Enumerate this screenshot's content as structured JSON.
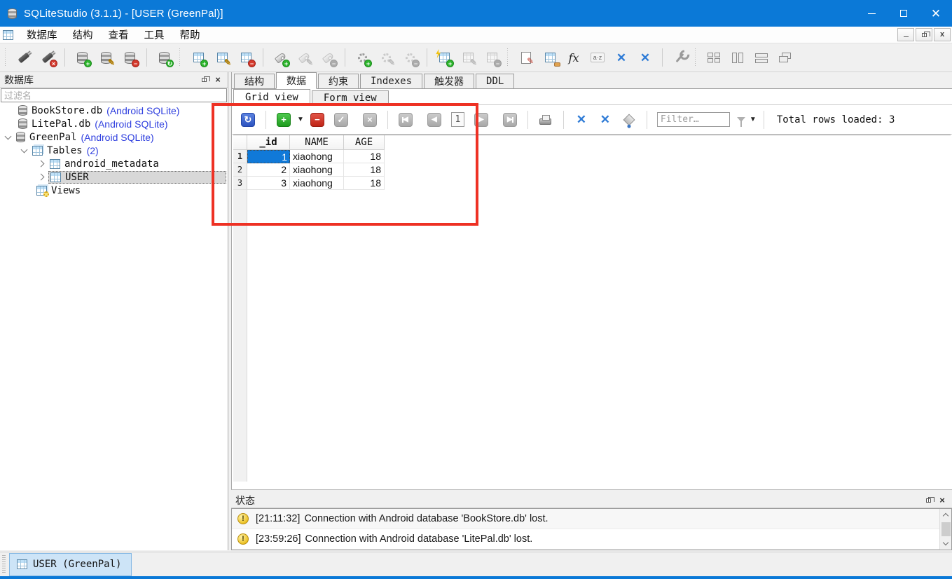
{
  "titlebar": {
    "title": "SQLiteStudio (3.1.1) - [USER (GreenPal)]"
  },
  "menubar": {
    "items": [
      "数据库",
      "结构",
      "查看",
      "工具",
      "帮助"
    ]
  },
  "main_toolbar": {
    "icons": [
      "connect-icon",
      "disconnect-icon",
      "add-database-icon",
      "edit-database-icon",
      "remove-database-icon",
      "refresh-schema-icon",
      "new-table-icon",
      "edit-table-icon",
      "drop-table-icon",
      "add-index-icon",
      "edit-index-icon",
      "drop-index-icon",
      "add-trigger-icon",
      "edit-trigger-icon",
      "drop-trigger-icon",
      "add-view-icon",
      "edit-view-icon",
      "drop-view-icon",
      "open-sql-editor-icon",
      "import-icon",
      "functions-icon",
      "collations-icon",
      "close-all-windows-icon",
      "restore-all-windows-icon",
      "settings-icon",
      "mdi-tile-icon",
      "mdi-tile-vertical-icon",
      "mdi-tile-horizontal-icon",
      "mdi-cascade-icon"
    ]
  },
  "databases_panel": {
    "title": "数据库",
    "filter_placeholder": "过滤名",
    "tree": [
      {
        "label": "BookStore.db",
        "suffix": "(Android SQLite)"
      },
      {
        "label": "LitePal.db",
        "suffix": "(Android SQLite)"
      },
      {
        "label": "GreenPal",
        "suffix": "(Android SQLite)"
      },
      {
        "label": "Tables",
        "suffix": "(2)"
      },
      {
        "label": "android_metadata",
        "suffix": ""
      },
      {
        "label": "USER",
        "suffix": ""
      },
      {
        "label": "Views",
        "suffix": ""
      }
    ]
  },
  "editor": {
    "tabs": [
      "结构",
      "数据",
      "约束",
      "Indexes",
      "触发器",
      "DDL"
    ],
    "active_tab": "数据",
    "view_tabs": [
      "Grid view",
      "Form view"
    ],
    "active_view_tab": "Grid view",
    "grid_toolbar": {
      "page_number": "1",
      "filter_placeholder": "Filter…",
      "total_rows_label": "Total rows loaded: 3",
      "icons": [
        "refresh-grid-icon",
        "add-row-icon",
        "add-row-dropdown-icon",
        "delete-row-icon",
        "commit-icon",
        "rollback-icon",
        "first-page-icon",
        "prev-page-icon",
        "next-page-icon",
        "last-page-icon",
        "print-icon",
        "shrink-columns-icon",
        "expand-columns-icon",
        "paint-bucket-icon",
        "filter-funnel-icon",
        "filter-dropdown-icon"
      ]
    },
    "grid": {
      "columns": [
        "_id",
        "NAME",
        "AGE"
      ],
      "row_numbers": [
        "1",
        "2",
        "3"
      ],
      "rows": [
        [
          "1",
          "xiaohong",
          "18"
        ],
        [
          "2",
          "xiaohong",
          "18"
        ],
        [
          "3",
          "xiaohong",
          "18"
        ]
      ],
      "selected_cell": {
        "row": 1,
        "column": "_id",
        "value": "1"
      }
    }
  },
  "status_panel": {
    "title": "状态",
    "messages": [
      {
        "time": "[21:11:32]",
        "text": "Connection with Android database 'BookStore.db' lost."
      },
      {
        "time": "[23:59:26]",
        "text": "Connection with Android database 'LitePal.db' lost."
      }
    ]
  },
  "taskbar": {
    "active_window": "USER (GreenPal)"
  },
  "colors": {
    "titlebar": "#0b79d7",
    "link_blue": "#3040df",
    "selection_blue": "#1079d8",
    "annotation_red": "#ee3124",
    "warning_yellow": "#ecc227"
  }
}
